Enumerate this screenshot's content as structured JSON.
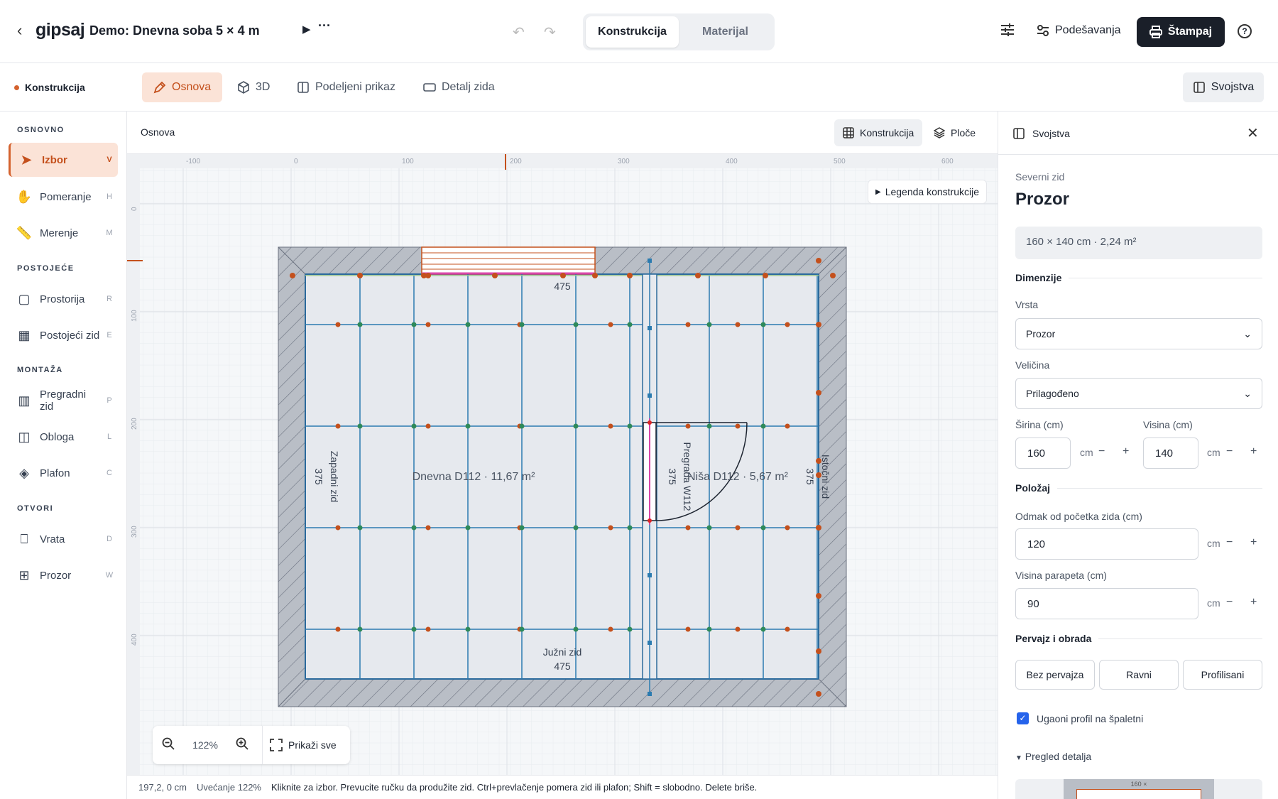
{
  "app": {
    "back_icon": "chevron-left-icon",
    "logo": "gipsaj",
    "project_title": "Demo: Dnevna soba 5 × 4 m",
    "play_icon": "play-icon",
    "more_icon": "more-icon"
  },
  "header": {
    "tabs": [
      {
        "label": "Konstrukcija",
        "active": true
      },
      {
        "label": "Materijal",
        "active": false
      }
    ],
    "settings_label": "Podešavanja",
    "print_label": "Štampaj",
    "help_label": "?"
  },
  "modebar": {
    "breadcrumb": "Konstrukcija",
    "tabs": [
      {
        "label": "Osnova",
        "active": true
      },
      {
        "label": "3D"
      },
      {
        "label": "Podeljeni prikaz"
      },
      {
        "label": "Detalj zida"
      }
    ],
    "properties_label": "Svojstva"
  },
  "sidebar": {
    "sections": [
      {
        "title": "OSNOVNO",
        "items": [
          {
            "label": "Izbor",
            "key": "V",
            "icon": "cursor-icon",
            "active": true
          },
          {
            "label": "Pomeranje",
            "key": "H",
            "icon": "hand-icon"
          },
          {
            "label": "Merenje",
            "key": "M",
            "icon": "ruler-icon"
          }
        ]
      },
      {
        "title": "POSTOJEĆE",
        "items": [
          {
            "label": "Prostorija",
            "key": "R",
            "icon": "room-icon"
          },
          {
            "label": "Postojeći zid",
            "key": "E",
            "icon": "brick-wall-icon"
          }
        ]
      },
      {
        "title": "MONTAŽA",
        "items": [
          {
            "label": "Pregradni zid",
            "key": "P",
            "icon": "studs-icon"
          },
          {
            "label": "Obloga",
            "key": "L",
            "icon": "lining-icon"
          },
          {
            "label": "Plafon",
            "key": "C",
            "icon": "ceiling-icon"
          }
        ]
      },
      {
        "title": "OTVORI",
        "items": [
          {
            "label": "Vrata",
            "key": "D",
            "icon": "door-icon"
          },
          {
            "label": "Prozor",
            "key": "W",
            "icon": "window-icon"
          }
        ]
      }
    ]
  },
  "canvas": {
    "title": "Osnova",
    "layers": [
      {
        "label": "Konstrukcija",
        "active": true
      },
      {
        "label": "Ploče"
      }
    ],
    "legend_label": "Legenda konstrukcije",
    "ruler_x": [
      "-100",
      "0",
      "100",
      "200",
      "300",
      "400",
      "500",
      "600"
    ],
    "ruler_y": [
      "0",
      "100",
      "200",
      "300",
      "400"
    ],
    "labels": {
      "north_len": "475",
      "south_name": "Južni zid",
      "south_len": "475",
      "west_name": "Zapadni zid",
      "west_len": "375",
      "east_name": "Istočni zid",
      "east_len": "375",
      "partition_name": "Pregrada W112",
      "partition_len": "375",
      "room1": "Dnevna D112 · 11,67 m²",
      "room2": "Niša D112 · 5,67 m²"
    },
    "zoom": {
      "out_icon": "zoom-out-icon",
      "value": "122%",
      "in_icon": "zoom-in-icon",
      "fit_label": "Prikaži sve"
    },
    "status": {
      "coords": "197,2, 0 cm",
      "zoom": "Uvećanje 122%",
      "hint": "Kliknite za izbor. Prevucite ručku da produžite zid. Ctrl+prevlačenje pomera zid ili plafon; Shift = slobodno. Delete briše."
    }
  },
  "panel": {
    "header": "Svojstva",
    "subtitle": "Severni zid",
    "title": "Prozor",
    "info": "160 × 140 cm · 2,24 m²",
    "dimensions_heading": "Dimenzije",
    "type_label": "Vrsta",
    "type_value": "Prozor",
    "size_label": "Veličina",
    "size_value": "Prilagođeno",
    "width_label": "Širina (cm)",
    "width_value": "160",
    "height_label": "Visina (cm)",
    "height_value": "140",
    "unit": "cm",
    "position_heading": "Položaj",
    "offset_label": "Odmak od početka zida (cm)",
    "offset_value": "120",
    "sill_label": "Visina parapeta (cm)",
    "sill_value": "90",
    "trim_heading": "Pervajz i obrada",
    "trim_options": [
      "Bez pervajza",
      "Ravni",
      "Profilisani"
    ],
    "corner_profile_label": "Ugaoni profil na špaletni",
    "corner_profile_checked": true,
    "detail_label": "Pregled detalja",
    "detail_dim": "160 ×"
  }
}
